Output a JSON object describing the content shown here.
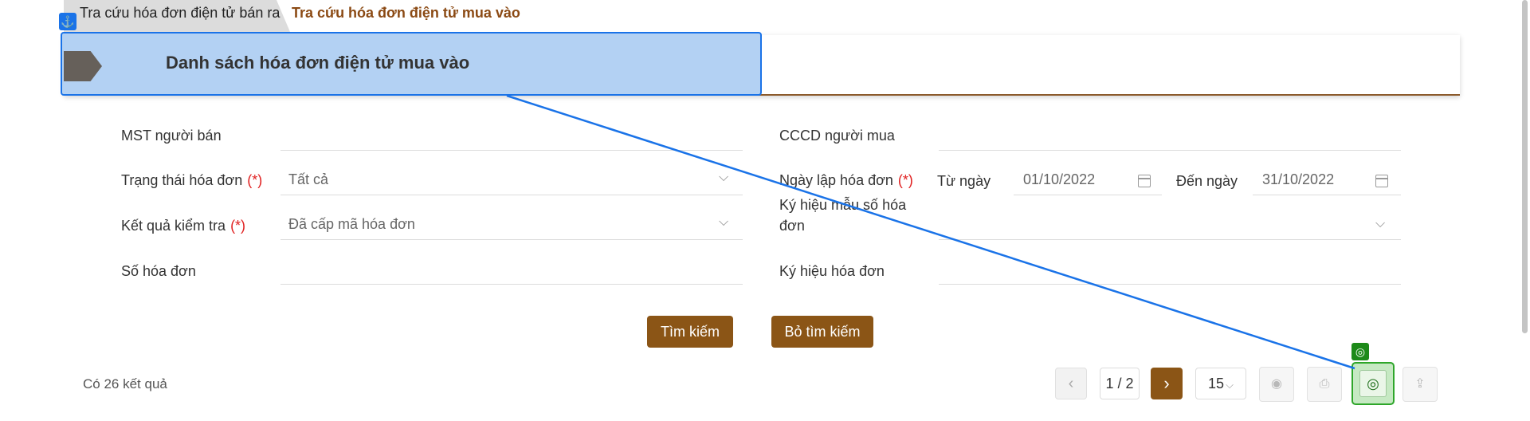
{
  "tabs": [
    {
      "label": "Tra cứu hóa đơn điện tử bán ra",
      "active": false
    },
    {
      "label": "Tra cứu hóa đơn điện tử mua vào",
      "active": true
    }
  ],
  "page_title": "Danh sách hóa đơn điện tử mua vào",
  "form": {
    "seller_tax_code": {
      "label": "MST người bán",
      "value": ""
    },
    "buyer_id": {
      "label": "CCCD người mua",
      "value": ""
    },
    "invoice_status": {
      "label": "Trạng thái hóa đơn",
      "required_mark": "(*)",
      "value": "Tất cả"
    },
    "invoice_date": {
      "label": "Ngày lập hóa đơn",
      "required_mark": "(*)",
      "from_label": "Từ ngày",
      "from_value": "01/10/2022",
      "to_label": "Đến ngày",
      "to_value": "31/10/2022"
    },
    "check_result": {
      "label": "Kết quả kiểm tra",
      "required_mark": "(*)",
      "value": "Đã cấp mã hóa đơn"
    },
    "template_symbol": {
      "label_line1": "Ký hiệu mẫu số hóa",
      "label_line2": "đơn",
      "value": ""
    },
    "invoice_number": {
      "label": "Số hóa đơn",
      "value": ""
    },
    "invoice_symbol": {
      "label": "Ký hiệu hóa đơn",
      "value": ""
    }
  },
  "buttons": {
    "search": "Tìm kiếm",
    "clear_search": "Bỏ tìm kiếm"
  },
  "results_text": "Có 26 kết quả",
  "pagination": {
    "page": "1 / 2",
    "page_size": "15"
  },
  "icons": {
    "prev": "‹",
    "next": "›",
    "chevron": "⌵",
    "view": "◉",
    "print": "⎙",
    "target": "◎",
    "export": "⇪",
    "anchor": "⚓"
  },
  "colors": {
    "brand_brown": "#8b5516",
    "highlight_blue": "#b3d1f3",
    "annotation_blue": "#1a73e8",
    "target_green": "#2ea62a",
    "required_red": "#e02020"
  }
}
